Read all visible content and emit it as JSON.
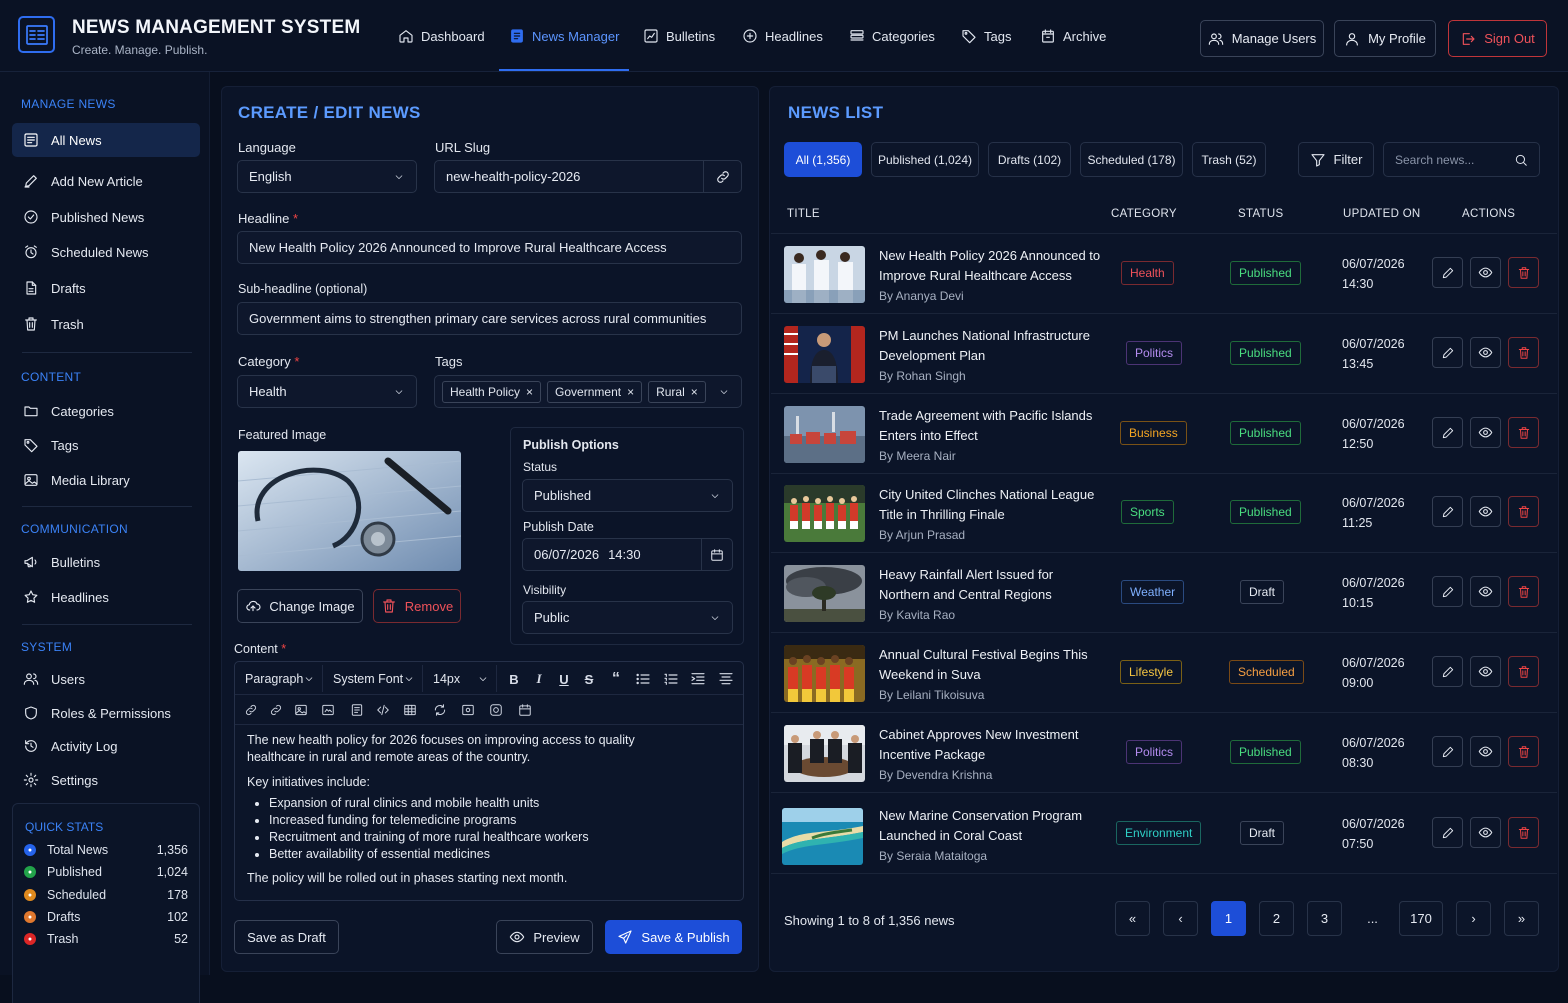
{
  "app": {
    "title": "NEWS MANAGEMENT SYSTEM",
    "tagline": "Create. Manage. Publish."
  },
  "nav": [
    {
      "label": "Dashboard",
      "icon": "home-icon"
    },
    {
      "label": "News Manager",
      "icon": "newspaper-icon",
      "active": true
    },
    {
      "label": "Bulletins",
      "icon": "bulletin-icon"
    },
    {
      "label": "Headlines",
      "icon": "plus-circle-icon"
    },
    {
      "label": "Categories",
      "icon": "layers-icon"
    },
    {
      "label": "Tags",
      "icon": "tag-icon"
    },
    {
      "label": "Archive",
      "icon": "archive-icon"
    }
  ],
  "header_actions": {
    "manage_users": "Manage Users",
    "my_profile": "My Profile",
    "sign_out": "Sign Out"
  },
  "sidebar": {
    "manage_title": "MANAGE NEWS",
    "manage": [
      "All News",
      "Add New Article",
      "Published News",
      "Scheduled News",
      "Drafts",
      "Trash"
    ],
    "content_title": "CONTENT",
    "content": [
      "Categories",
      "Tags",
      "Media Library"
    ],
    "comm_title": "COMMUNICATION",
    "comm": [
      "Bulletins",
      "Headlines"
    ],
    "system_title": "SYSTEM",
    "system": [
      "Users",
      "Roles & Permissions",
      "Activity Log",
      "Settings"
    ]
  },
  "quick_stats": {
    "title": "QUICK STATS",
    "items": [
      {
        "label": "Total News",
        "value": "1,356",
        "color": "#2563eb"
      },
      {
        "label": "Published",
        "value": "1,024",
        "color": "#22a34a"
      },
      {
        "label": "Scheduled",
        "value": "178",
        "color": "#e08a1e"
      },
      {
        "label": "Drafts",
        "value": "102",
        "color": "#e0782e"
      },
      {
        "label": "Trash",
        "value": "52",
        "color": "#dc2626"
      }
    ]
  },
  "editor": {
    "title": "CREATE / EDIT NEWS",
    "language_label": "Language",
    "language": "English",
    "slug_label": "URL Slug",
    "slug": "new-health-policy-2026",
    "headline_label": "Headline",
    "headline": "New Health Policy 2026 Announced to Improve Rural Healthcare Access",
    "sub_label": "Sub-headline (optional)",
    "sub": "Government aims to strengthen primary care services across rural communities",
    "category_label": "Category",
    "category": "Health",
    "tags_label": "Tags",
    "tags": [
      "Health Policy",
      "Government",
      "Rural"
    ],
    "image_label": "Featured Image",
    "change_image": "Change Image",
    "remove": "Remove",
    "publish_title": "Publish Options",
    "status_label": "Status",
    "status": "Published",
    "date_label": "Publish Date",
    "date": "06/07/2026",
    "time": "14:30",
    "visibility_label": "Visibility",
    "visibility": "Public",
    "content_label": "Content",
    "toolbar": {
      "block": "Paragraph",
      "font": "System Font",
      "size": "14px"
    },
    "content_p1": "The new health policy for 2026 focuses on improving access to quality healthcare in rural and remote areas of the country.",
    "content_p2": "Key initiatives include:",
    "content_list": [
      "Expansion of rural clinics and mobile health units",
      "Increased funding for telemedicine programs",
      "Recruitment and training of more rural healthcare workers",
      "Better availability of essential medicines"
    ],
    "content_p3": "The policy will be rolled out in phases starting next month.",
    "save_draft": "Save as Draft",
    "preview": "Preview",
    "save_publish": "Save & Publish"
  },
  "news_list": {
    "title": "NEWS LIST",
    "filters": [
      "All (1,356)",
      "Published (1,024)",
      "Drafts (102)",
      "Scheduled (178)",
      "Trash (52)"
    ],
    "filter_btn": "Filter",
    "search_placeholder": "Search news...",
    "columns": [
      "TITLE",
      "CATEGORY",
      "STATUS",
      "UPDATED ON",
      "ACTIONS"
    ],
    "rows": [
      {
        "title": "New Health Policy 2026 Announced to Improve Rural Healthcare Access",
        "author": "By Ananya Devi",
        "category": "Health",
        "status": "Published",
        "date": "06/07/2026",
        "time": "14:30"
      },
      {
        "title": "PM Launches National Infrastructure Development Plan",
        "author": "By Rohan Singh",
        "category": "Politics",
        "status": "Published",
        "date": "06/07/2026",
        "time": "13:45"
      },
      {
        "title": "Trade Agreement with Pacific Islands Enters into Effect",
        "author": "By Meera Nair",
        "category": "Business",
        "status": "Published",
        "date": "06/07/2026",
        "time": "12:50"
      },
      {
        "title": "City United Clinches National League Title in Thrilling Finale",
        "author": "By Arjun Prasad",
        "category": "Sports",
        "status": "Published",
        "date": "06/07/2026",
        "time": "11:25"
      },
      {
        "title": "Heavy Rainfall Alert Issued for Northern and Central Regions",
        "author": "By Kavita Rao",
        "category": "Weather",
        "status": "Draft",
        "date": "06/07/2026",
        "time": "10:15"
      },
      {
        "title": "Annual Cultural Festival Begins This Weekend in Suva",
        "author": "By Leilani Tikoisuva",
        "category": "Lifestyle",
        "status": "Scheduled",
        "date": "06/07/2026",
        "time": "09:00"
      },
      {
        "title": "Cabinet Approves New Investment Incentive Package",
        "author": "By Devendra Krishna",
        "category": "Politics",
        "status": "Published",
        "date": "06/07/2026",
        "time": "08:30"
      },
      {
        "title": "New Marine Conservation Program Launched in Coral Coast",
        "author": "By Seraia Mataitoga",
        "category": "Environment",
        "status": "Draft",
        "date": "06/07/2026",
        "time": "07:50"
      }
    ],
    "showing": "Showing 1 to 8 of 1,356 news",
    "pages": [
      "«",
      "‹",
      "1",
      "2",
      "3",
      "...",
      "170",
      "›",
      "»"
    ],
    "current_page": "1"
  },
  "category_colors": {
    "Health": {
      "fg": "#f0525a",
      "bd": "#7a2a30"
    },
    "Politics": {
      "fg": "#b48cf0",
      "bd": "#4c3475"
    },
    "Business": {
      "fg": "#f5a623",
      "bd": "#7a5216"
    },
    "Sports": {
      "fg": "#4ade80",
      "bd": "#1f6b3a"
    },
    "Weather": {
      "fg": "#7fb0ff",
      "bd": "#2a4a80"
    },
    "Lifestyle": {
      "fg": "#f5c542",
      "bd": "#7a6016"
    },
    "Environment": {
      "fg": "#2fd0c6",
      "bd": "#1a6660"
    }
  },
  "status_colors": {
    "Published": {
      "fg": "#4ade80",
      "bd": "#1f6b3a"
    },
    "Draft": {
      "fg": "#e6eaf2",
      "bd": "#3a4459"
    },
    "Scheduled": {
      "fg": "#f59e42",
      "bd": "#7a4a16"
    }
  }
}
